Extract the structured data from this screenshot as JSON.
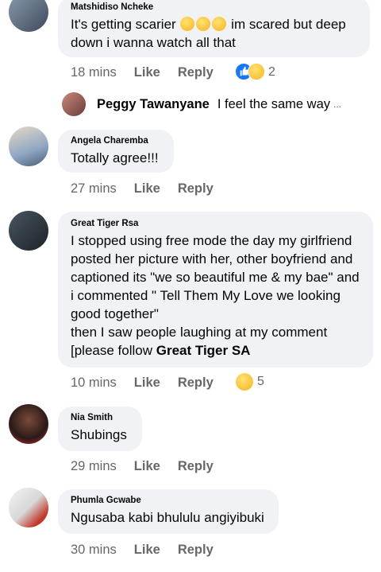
{
  "comments": [
    {
      "author": "Matshidiso Ncheke",
      "lines": [
        "It's getting scarier",
        " im scared but deep",
        "down i wanna watch all that"
      ],
      "time": "18 mins",
      "like": "Like",
      "reply": "Reply",
      "reaction_count": "2"
    },
    {
      "author": "Angela Charemba",
      "lines": [
        "Totally agree!!!"
      ],
      "time": "27 mins",
      "like": "Like",
      "reply": "Reply"
    },
    {
      "author": "Great Tiger Rsa",
      "lines": [
        "I stopped using free mode the day my girlfriend",
        "posted her picture with her, other boyfriend and",
        "captioned its \"we so beautiful me & my bae\" and",
        "i commented \" Tell Them My Love we looking",
        "good together\"",
        "then I saw people laughing at my comment",
        "[please follow "
      ],
      "bold_tail": "Great Tiger SA",
      "time": "10 mins",
      "like": "Like",
      "reply": "Reply",
      "reaction_count": "5"
    },
    {
      "author": "Nia Smith",
      "lines": [
        "Shubings"
      ],
      "time": "29 mins",
      "like": "Like",
      "reply": "Reply"
    },
    {
      "author": "Phumla Gcwabe",
      "lines": [
        "Ngusaba kabi bhululu angiyibuki"
      ],
      "time": "30 mins",
      "like": "Like",
      "reply": "Reply"
    }
  ],
  "reply_preview": {
    "name": "Peggy Tawanyane",
    "snippet": "I feel the same way",
    "ellipsis": "..."
  },
  "colors": {
    "bubble": "#f0f2f5",
    "meta": "#65676b",
    "like_blue": "#1877f2",
    "haha_yellow": "#f7b125"
  },
  "icons": {
    "reaction_like": "like-reaction-icon",
    "reaction_haha": "haha-reaction-icon",
    "inline_emoji": "tears-of-joy-emoji"
  }
}
